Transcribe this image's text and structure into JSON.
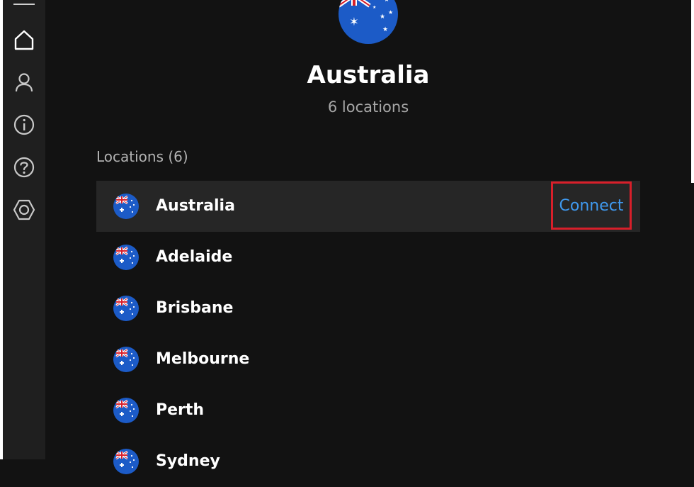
{
  "colors": {
    "background": "#121212",
    "sidebar": "#1f1f1f",
    "selected_row": "#262626",
    "accent_link": "#3f99ef",
    "highlight_border": "#d81f2a",
    "muted_text": "#a7a7a7"
  },
  "sidebar": {
    "items": [
      {
        "icon": "home-icon"
      },
      {
        "icon": "user-icon"
      },
      {
        "icon": "info-icon"
      },
      {
        "icon": "help-icon"
      },
      {
        "icon": "settings-icon"
      }
    ]
  },
  "header": {
    "flag_icon": "australia-flag-icon",
    "title": "Australia",
    "subtitle": "6 locations"
  },
  "locations": {
    "section_label": "Locations (6)",
    "connect_label": "Connect",
    "items": [
      {
        "label": "Australia",
        "selected": true
      },
      {
        "label": "Adelaide"
      },
      {
        "label": "Brisbane"
      },
      {
        "label": "Melbourne"
      },
      {
        "label": "Perth"
      },
      {
        "label": "Sydney"
      }
    ]
  }
}
